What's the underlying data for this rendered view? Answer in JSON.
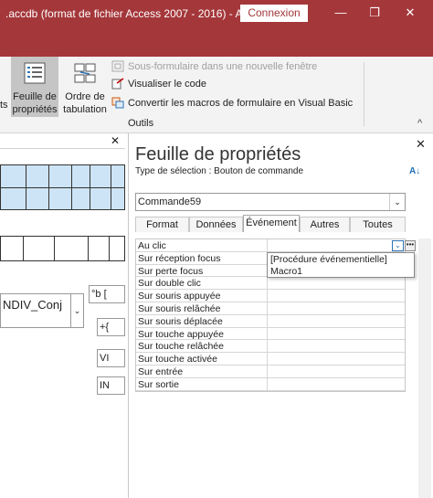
{
  "titlebar": {
    "title": ".accdb (format de fichier Access 2007 - 2016)  -  A...",
    "connexion_label": "Connexion",
    "minimize_glyph": "—",
    "restore_glyph": "❐",
    "close_glyph": "✕",
    "accent_color": "#a4373a"
  },
  "ribbon": {
    "left_fragment": "ts",
    "feuille_label": "Feuille de propriétés",
    "ordre_label": "Ordre de tabulation",
    "sous_formulaire_label": "Sous-formulaire dans une nouvelle fenêtre",
    "visualiser_label": "Visualiser le code",
    "convertir_label": "Convertir les macros de formulaire en Visual Basic",
    "group_label": "Outils",
    "collapse_glyph": "^"
  },
  "design": {
    "close_glyph": "✕",
    "combo_text": "NDIV_Conj",
    "combo_arrow": "⌄",
    "mini1": "°b [",
    "mini2": "+{",
    "mini3": "VI",
    "mini4": "IN"
  },
  "property_sheet": {
    "close_glyph": "✕",
    "title": "Feuille de propriétés",
    "selection_type": "Type de sélection :  Bouton de commande",
    "sort_glyph": "A↓",
    "selected_object": "Commande59",
    "tabs": [
      "Format",
      "Données",
      "Événement",
      "Autres",
      "Toutes"
    ],
    "active_tab": "Événement",
    "properties": [
      "Au clic",
      "Sur réception focus",
      "Sur perte focus",
      "Sur double clic",
      "Sur souris appuyée",
      "Sur souris relâchée",
      "Sur souris déplacée",
      "Sur touche appuyée",
      "Sur touche relâchée",
      "Sur touche activée",
      "Sur entrée",
      "Sur sortie"
    ],
    "dropdown_options": [
      "[Procédure événementielle]",
      "Macro1"
    ],
    "build_glyph": "•••"
  }
}
